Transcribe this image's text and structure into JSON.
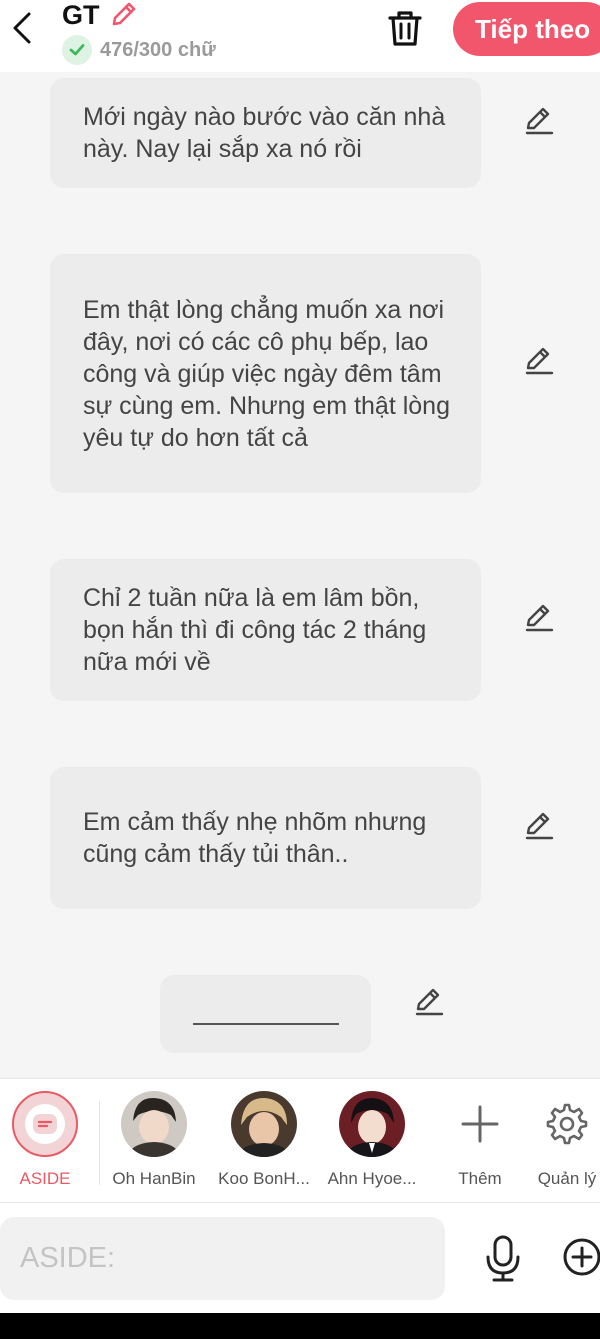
{
  "header": {
    "title": "GT",
    "word_count": "476/300 chữ",
    "next_label": "Tiếp theo"
  },
  "messages": [
    {
      "text": "Mới ngày nào bước vào căn nhà này. Nay lại sắp xa nó rồi"
    },
    {
      "text": "Em thật lòng chẳng muốn xa nơi đây, nơi có các cô phụ bếp, lao công và giúp việc ngày đêm tâm sự cùng em. Nhưng em thật lòng yêu tự do hơn tất cả"
    },
    {
      "text": "Chỉ 2 tuần nữa là em lâm bồn, bọn hắn thì đi công tác 2 tháng nữa mới về"
    },
    {
      "text": "Em cảm thấy nhẹ nhõm nhưng cũng cảm thấy tủi thân.."
    }
  ],
  "characters": [
    {
      "label": "ASIDE",
      "color": "#e85a64"
    },
    {
      "label": "Oh HanBin"
    },
    {
      "label": "Koo BonH..."
    },
    {
      "label": "Ahn Hyoe..."
    },
    {
      "label": "Thêm",
      "icon": "plus-icon"
    },
    {
      "label": "Quản lý",
      "icon": "gear-icon"
    }
  ],
  "input": {
    "placeholder": "ASIDE:"
  },
  "colors": {
    "accent": "#f2566c",
    "bubble": "#ececec",
    "check_green": "#3bb85a"
  }
}
